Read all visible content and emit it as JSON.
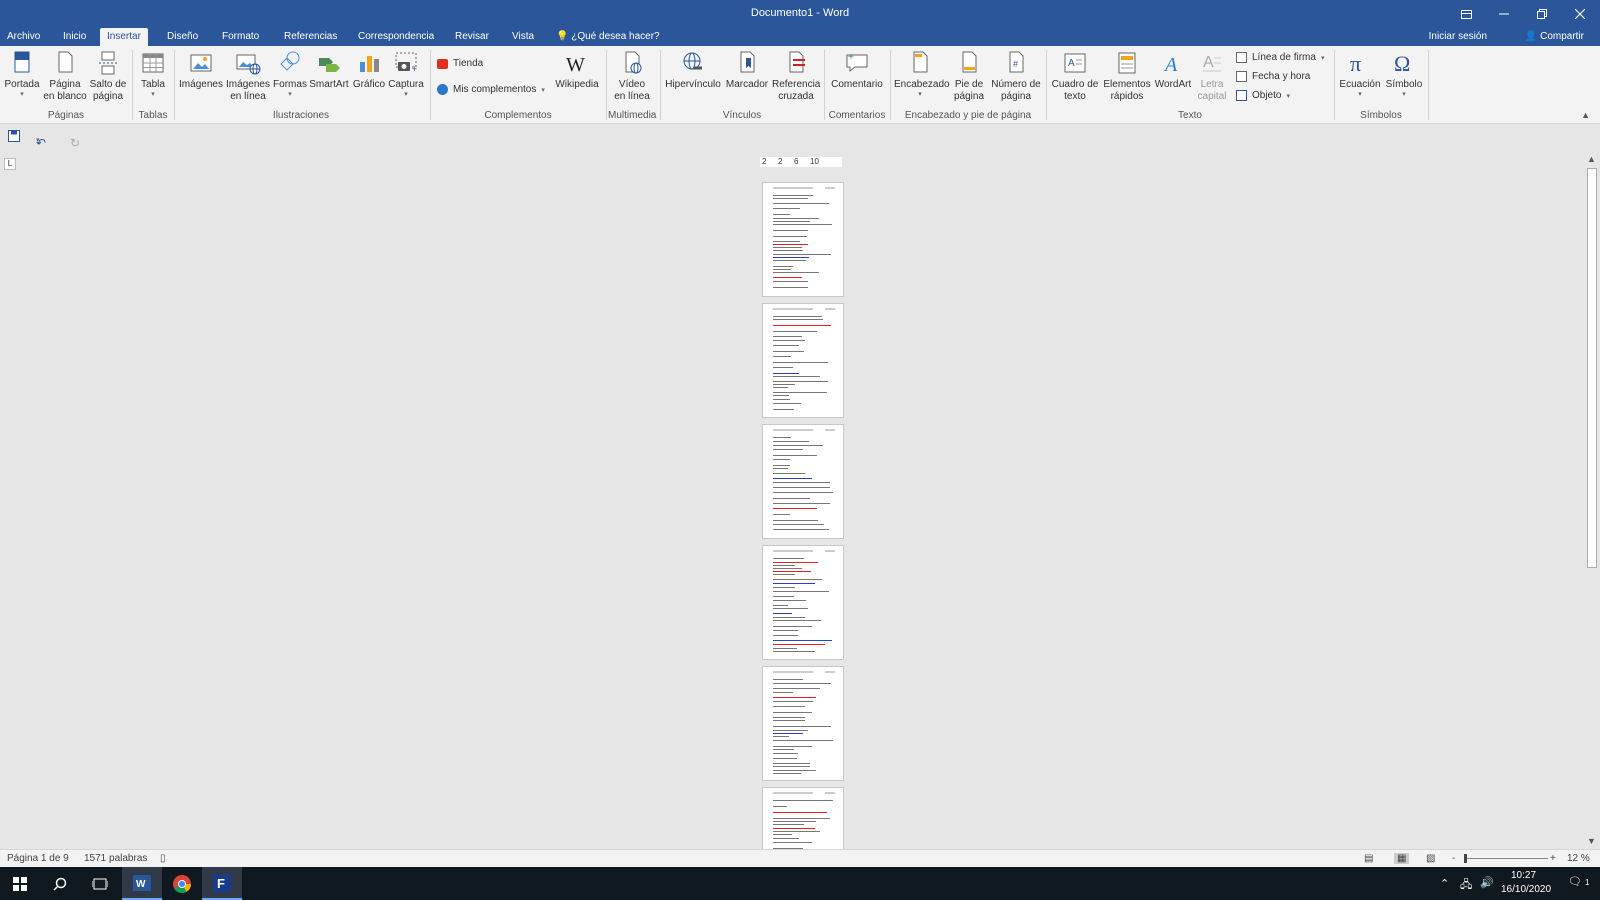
{
  "window": {
    "title": "Documento1 - Word",
    "controls": [
      "▭",
      "─",
      "❐",
      "✕"
    ]
  },
  "tabs": [
    {
      "label": "Archivo"
    },
    {
      "label": "Inicio"
    },
    {
      "label": "Insertar",
      "active": true
    },
    {
      "label": "Diseño"
    },
    {
      "label": "Formato"
    },
    {
      "label": "Referencias"
    },
    {
      "label": "Correspondencia"
    },
    {
      "label": "Revisar"
    },
    {
      "label": "Vista"
    }
  ],
  "tell_me": "¿Qué desea hacer?",
  "account": {
    "signin": "Iniciar sesión",
    "share": "Compartir"
  },
  "ribbon": {
    "groups": {
      "paginas": "Páginas",
      "tablas": "Tablas",
      "ilustraciones": "Ilustraciones",
      "complementos": "Complementos",
      "multimedia": "Multimedia",
      "vinculos": "Vínculos",
      "comentarios": "Comentarios",
      "encabezado": "Encabezado y pie de página",
      "texto": "Texto",
      "simbolos": "Símbolos"
    },
    "buttons": {
      "portada": "Portada",
      "pagina_blanco_1": "Página",
      "pagina_blanco_2": "en blanco",
      "salto_1": "Salto de",
      "salto_2": "página",
      "tabla": "Tabla",
      "imagenes": "Imágenes",
      "img_linea_1": "Imágenes",
      "img_linea_2": "en línea",
      "formas": "Formas",
      "smartart": "SmartArt",
      "grafico": "Gráfico",
      "captura": "Captura",
      "tienda": "Tienda",
      "mis_complementos": "Mis complementos",
      "wikipedia": "Wikipedia",
      "video_1": "Vídeo",
      "video_2": "en línea",
      "hipervinculo": "Hipervínculo",
      "marcador": "Marcador",
      "ref_1": "Referencia",
      "ref_2": "cruzada",
      "comentario": "Comentario",
      "encabezado": "Encabezado",
      "pie_1": "Pie de",
      "pie_2": "página",
      "num_1": "Número de",
      "num_2": "página",
      "cuadro_1": "Cuadro de",
      "cuadro_2": "texto",
      "elem_1": "Elementos",
      "elem_2": "rápidos",
      "wordart": "WordArt",
      "letra_1": "Letra",
      "letra_2": "capital",
      "linea_firma": "Línea de firma",
      "fecha_hora": "Fecha y hora",
      "objeto": "Objeto",
      "ecuacion": "Ecuación",
      "simbolo": "Símbolo"
    }
  },
  "ruler": {
    "ticks": [
      "2",
      "2",
      "6",
      "10"
    ]
  },
  "status": {
    "page": "Página 1 de 9",
    "words": "1571 palabras",
    "zoom": "12 %",
    "zoom_minus": "-",
    "zoom_plus": "+"
  },
  "taskbar": {
    "time": "10:27",
    "date": "16/10/2020",
    "notifications": "1"
  },
  "colors": {
    "accent": "#2b579a",
    "ribbon_bg": "#f3f3f3",
    "workspace_bg": "#e6e6e6",
    "taskbar_bg": "#101820"
  },
  "icons": [
    "save-icon",
    "undo-icon",
    "redo-icon",
    "search-icon",
    "windows-icon",
    "task-view-icon",
    "word-icon",
    "chrome-icon",
    "f-app-icon",
    "pi-icon",
    "omega-icon"
  ]
}
